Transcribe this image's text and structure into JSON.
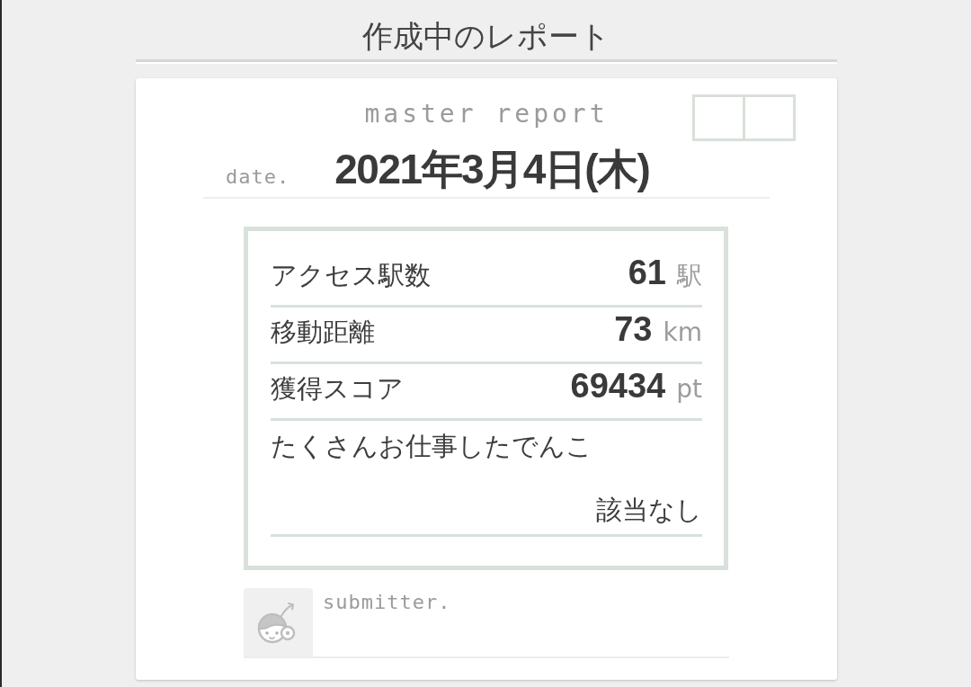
{
  "header": {
    "title": "作成中のレポート"
  },
  "report": {
    "heading": "master report",
    "date_label": "date.",
    "date": "2021年3月4日(木)",
    "stats": [
      {
        "kind": "metric",
        "label": "アクセス駅数",
        "value": "61",
        "unit": "駅"
      },
      {
        "kind": "metric",
        "label": "移動距離",
        "value": "73",
        "unit": "km"
      },
      {
        "kind": "metric",
        "label": "獲得スコア",
        "value": "69434",
        "unit": "pt"
      },
      {
        "kind": "note",
        "label": "たくさんお仕事したでんこ",
        "value": "該当なし"
      }
    ],
    "submitter_label": "submitter."
  }
}
